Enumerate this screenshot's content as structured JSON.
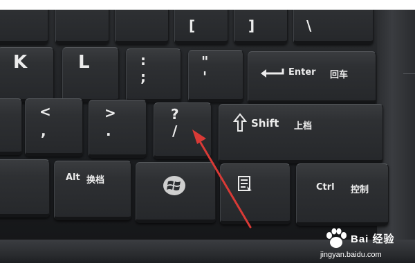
{
  "keys": {
    "top_row": [
      "[",
      "]",
      "\\"
    ],
    "k": "K",
    "l": "L",
    "semicolon": {
      "top": ":",
      "bottom": ";"
    },
    "quote": {
      "top": "\"",
      "bottom": "'"
    },
    "enter": {
      "label": "Enter",
      "cn": "回车"
    },
    "comma": {
      "top": "<",
      "bottom": ","
    },
    "period": {
      "top": ">",
      "bottom": "."
    },
    "slash": {
      "top": "?",
      "bottom": "/"
    },
    "shift": {
      "label": "Shift",
      "cn": "上档"
    },
    "alt": {
      "label": "Alt",
      "cn": "换档"
    },
    "ctrl": {
      "label": "Ctrl",
      "cn": "控制"
    }
  },
  "icons": [
    "windows-logo-icon",
    "menu-key-icon",
    "enter-arrow-icon",
    "shift-arrow-icon",
    "red-pointer-arrow"
  ],
  "watermark": {
    "brand": "Bai 经验",
    "url": "jingyan.baidu.com"
  },
  "colors": {
    "keycap": "#2e3033",
    "legend": "#ececec",
    "pointer": "#d93a36"
  }
}
